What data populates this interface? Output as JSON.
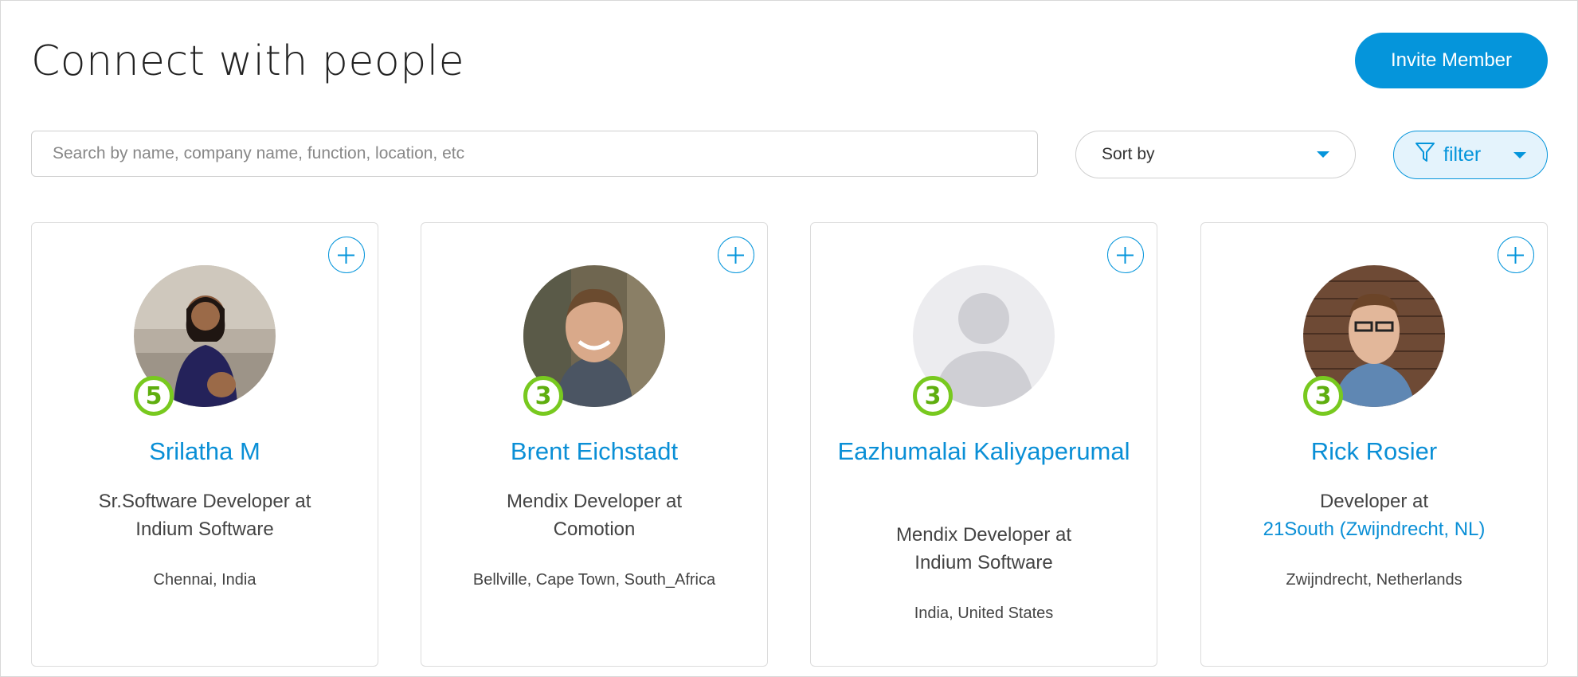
{
  "header": {
    "title": "Connect with people",
    "invite_label": "Invite Member"
  },
  "search": {
    "placeholder": "Search by name, company name, function, location, etc",
    "value": ""
  },
  "sort": {
    "label": "Sort by"
  },
  "filter": {
    "label": "filter",
    "icon": "filter-icon"
  },
  "colors": {
    "accent": "#0595db",
    "link": "#0a8fd6",
    "badge": "#78c91f",
    "filter_bg": "#e4f3fc"
  },
  "people": [
    {
      "name": "Srilatha M",
      "role": "Sr.Software Developer at",
      "company": "Indium Software",
      "company_is_link": false,
      "location": "Chennai, India",
      "level": "5",
      "avatar": "photo"
    },
    {
      "name": "Brent Eichstadt",
      "role": "Mendix Developer at",
      "company": "Comotion",
      "company_is_link": false,
      "location": "Bellville, Cape Town, South_Africa",
      "level": "3",
      "avatar": "photo"
    },
    {
      "name": "Eazhumalai Kaliyaperumal",
      "role": "Mendix Developer at",
      "company": "Indium Software",
      "company_is_link": false,
      "location": "India, United States",
      "level": "3",
      "avatar": "placeholder"
    },
    {
      "name": "Rick Rosier",
      "role": "Developer at",
      "company": "21South (Zwijndrecht, NL)",
      "company_is_link": true,
      "location": "Zwijndrecht, Netherlands",
      "level": "3",
      "avatar": "photo"
    }
  ]
}
